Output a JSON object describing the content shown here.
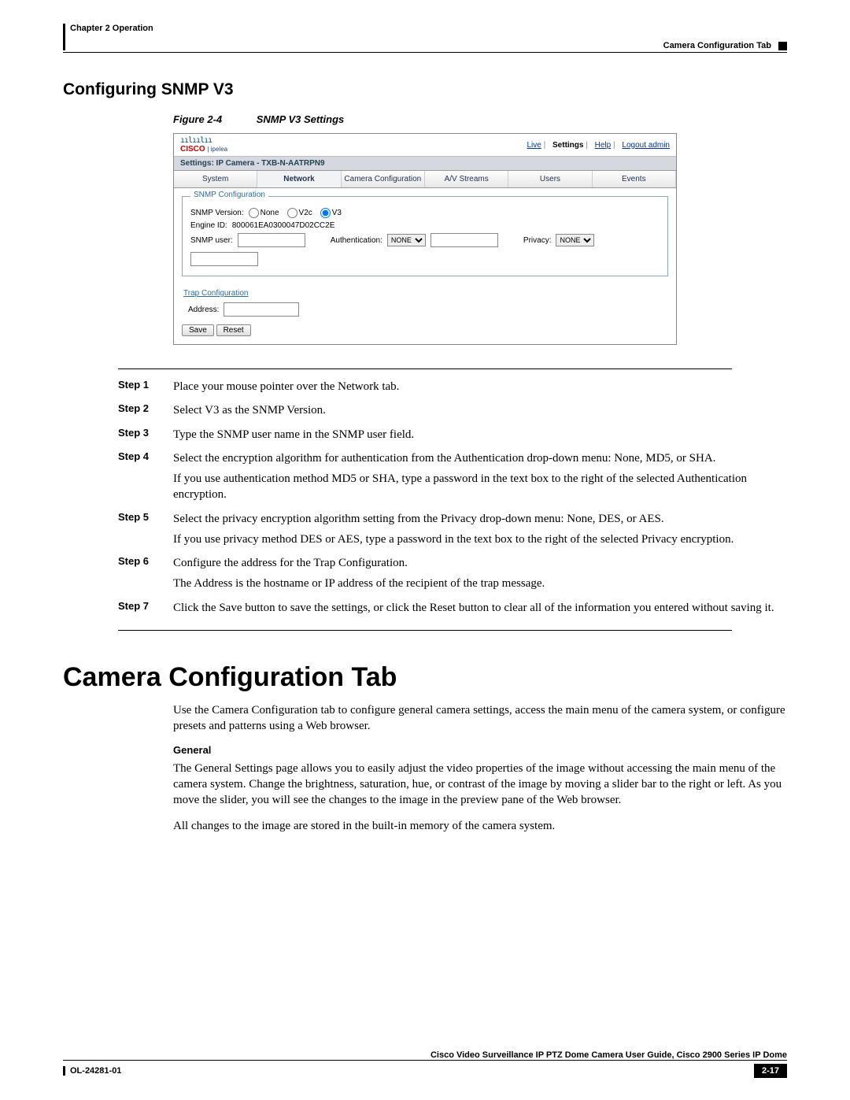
{
  "header": {
    "chapter": "Chapter 2    Operation",
    "breadcrumb": "Camera Configuration Tab"
  },
  "section_title": "Configuring SNMP V3",
  "figure": {
    "num": "Figure 2-4",
    "title": "SNMP V3 Settings"
  },
  "shot": {
    "logo_wave": "ıılıılıı",
    "logo_text": "CISCO",
    "logo_sub": "| ipelea",
    "links": {
      "live": "Live",
      "settings": "Settings",
      "help": "Help",
      "logout": "Logout admin"
    },
    "subhead": "Settings: IP Camera - TXB-N-AATRPN9",
    "tabs": [
      "System",
      "Network",
      "Camera Configuration",
      "A/V Streams",
      "Users",
      "Events"
    ],
    "active_tab": 1,
    "snmp": {
      "legend": "SNMP Configuration",
      "version_label": "SNMP Version:",
      "opt_none": "None",
      "opt_v2c": "V2c",
      "opt_v3": "V3",
      "engine_label": "Engine ID:",
      "engine_value": "800061EA0300047D02CC2E",
      "user_label": "SNMP user:",
      "auth_label": "Authentication:",
      "auth_value": "NONE",
      "priv_label": "Privacy:",
      "priv_value": "NONE"
    },
    "trap": {
      "link": "Trap Configuration",
      "address_label": "Address:"
    },
    "buttons": {
      "save": "Save",
      "reset": "Reset"
    }
  },
  "steps": [
    {
      "label": "Step 1",
      "paras": [
        "Place your mouse pointer over the Network tab."
      ]
    },
    {
      "label": "Step 2",
      "paras": [
        "Select V3 as the SNMP Version."
      ]
    },
    {
      "label": "Step 3",
      "paras": [
        "Type the SNMP user name in the SNMP user field."
      ]
    },
    {
      "label": "Step 4",
      "paras": [
        "Select the encryption algorithm for authentication from the Authentication drop-down menu: None, MD5, or SHA.",
        "If you use authentication method MD5 or SHA, type a password in the text box to the right of the selected Authentication encryption."
      ]
    },
    {
      "label": "Step 5",
      "paras": [
        "Select the privacy encryption algorithm setting from the Privacy drop-down menu: None, DES, or AES.",
        "If you use privacy method DES or AES, type a password in the text box to the right of the selected Privacy encryption."
      ]
    },
    {
      "label": "Step 6",
      "paras": [
        "Configure the address for the Trap Configuration.",
        "The Address is the hostname or IP address of the recipient of the trap message."
      ]
    },
    {
      "label": "Step 7",
      "paras": [
        "Click the Save button to save the settings, or click the Reset button to clear all of the information you entered without saving it."
      ]
    }
  ],
  "tab_section": {
    "title": "Camera Configuration Tab",
    "intro": "Use the Camera Configuration tab to configure general camera settings, access the main menu of the camera system, or configure presets and patterns using a Web browser.",
    "general_head": "General",
    "general_body": "The General Settings page allows you to easily adjust the video properties of the image without accessing the main menu of the camera system. Change the brightness, saturation, hue, or contrast of the image by moving a slider bar to the right or left. As you move the slider, you will see the changes to the image in the preview pane of the Web browser.",
    "general_body2": "All changes to the image are stored in the built-in memory of the camera system."
  },
  "footer": {
    "book": "Cisco Video Surveillance IP PTZ Dome Camera User Guide, Cisco 2900 Series IP Dome",
    "doc": "OL-24281-01",
    "page": "2-17"
  }
}
